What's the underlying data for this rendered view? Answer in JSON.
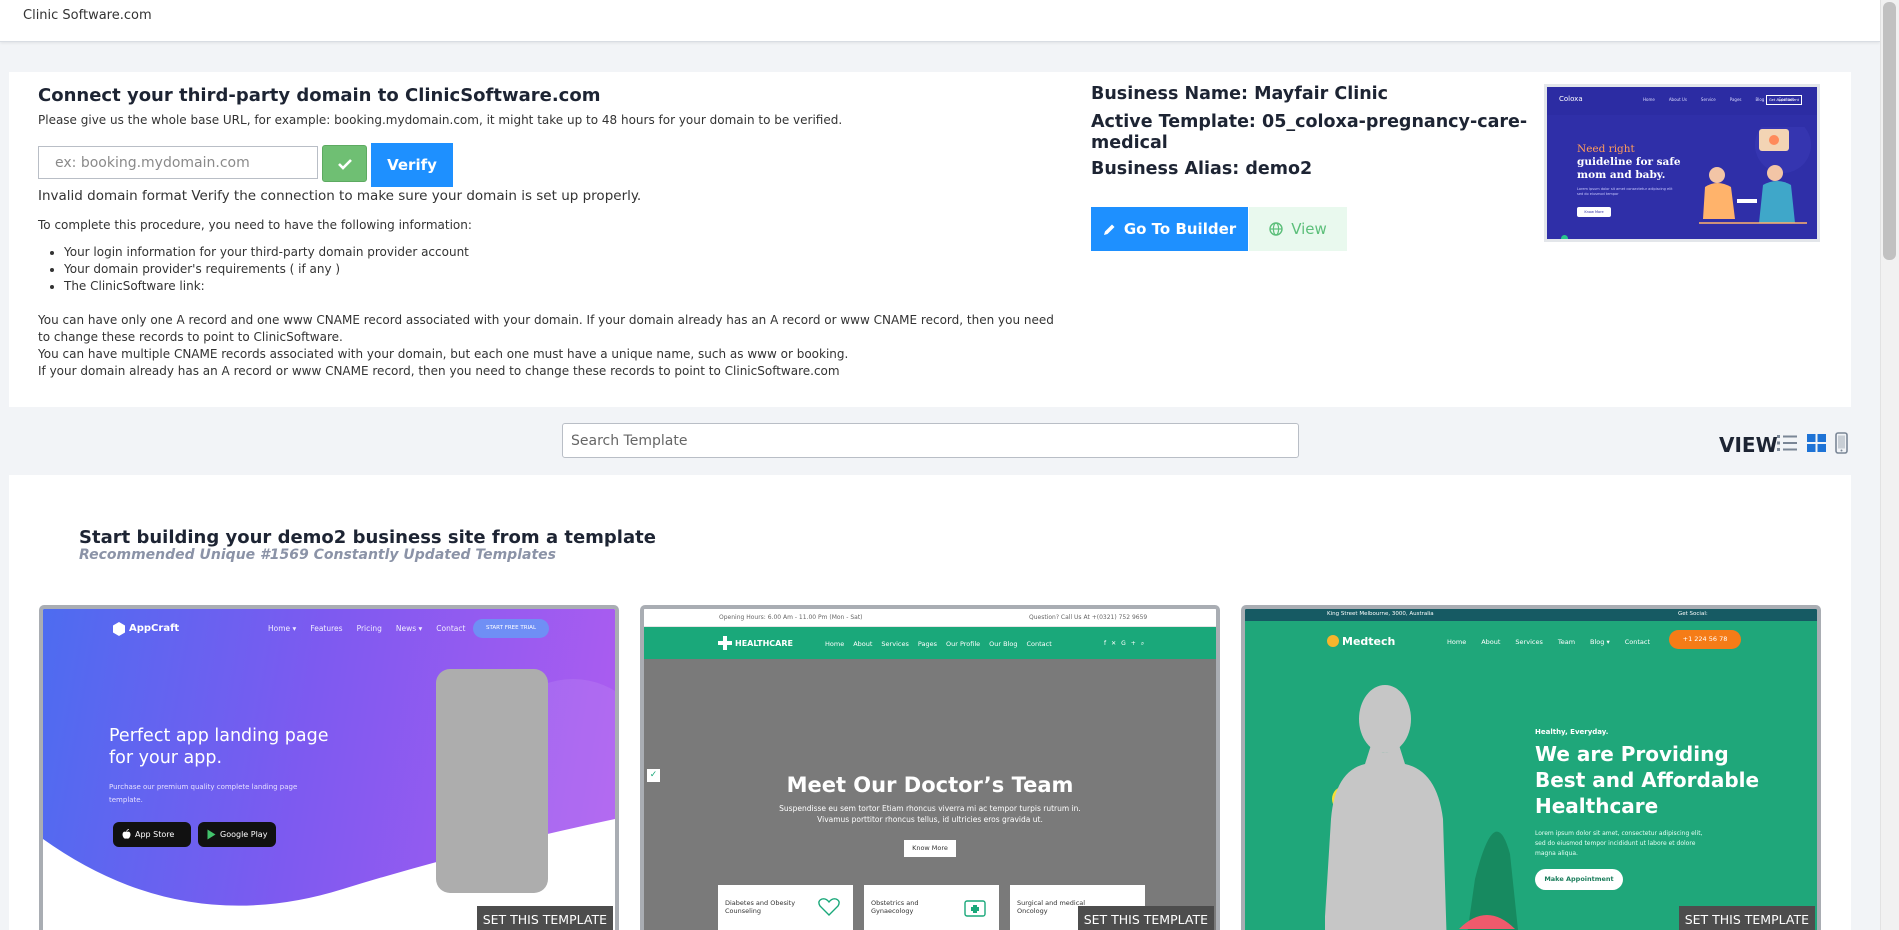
{
  "topbar": {
    "brand": "Clinic Software.com"
  },
  "domain": {
    "title": "Connect your third-party domain to ClinicSoftware.com",
    "help": "Please give us the whole base URL, for example: booking.mydomain.com, it might take up to 48 hours for your domain to be verified.",
    "input_placeholder": "ex: booking.mydomain.com",
    "verify_label": "Verify",
    "invalid_message": "Invalid domain format Verify the connection to make sure your domain is set up properly.",
    "info_intro": "To complete this procedure, you need to have the following information:",
    "requirements": [
      "Your login information for your third-party domain provider account",
      "Your domain provider's requirements ( if any )",
      "The ClinicSoftware link:"
    ],
    "notes": [
      "You can have only one A record and one www CNAME record associated with your domain. If your domain already has an A record or www CNAME record, then you need to change these records to point to ClinicSoftware.",
      "You can have multiple CNAME records associated with your domain, but each one must have a unique name, such as www or booking.",
      "If your domain already has an A record or www CNAME record, then you need to change these records to point to ClinicSoftware.com"
    ]
  },
  "business": {
    "name": "Business Name: Mayfair Clinic",
    "template": "Active Template: 05_coloxa-pregnancy-care-medical",
    "alias": "Business Alias: demo2",
    "builder_label": "Go To Builder",
    "view_label": "View",
    "preview": {
      "logo": "Coloxa",
      "nav": [
        "Home",
        "About Us",
        "Service",
        "Pages",
        "Blog",
        "Contact"
      ],
      "cta": "Get Appointment",
      "headline_1": "Need right",
      "headline_2": "guideline for safe",
      "headline_3": "mom and baby.",
      "body": "Lorem ipsum dolor sit amet consectetur adipiscing elit sed do eiusmod tempor",
      "button": "Know More"
    }
  },
  "search": {
    "placeholder": "Search Template",
    "view_label": "VIEW"
  },
  "templates": {
    "heading": "Start building your demo2 business site from a template",
    "subheading": "Recommended Unique #1569 Constantly Updated Templates",
    "set_label": "SET THIS TEMPLATE",
    "appcraft": {
      "logo": "AppCraft",
      "nav": [
        "Home ▾",
        "Features",
        "Pricing",
        "News ▾",
        "Contact"
      ],
      "cta": "START FREE TRIAL",
      "headline_1": "Perfect app landing page",
      "headline_2": "for your app.",
      "body_1": "Purchase our premium quality complete landing page",
      "body_2": "template.",
      "store_1": "App Store",
      "store_2": "Google Play"
    },
    "healthcare": {
      "hours": "Opening Hours: 6.00 Am - 11.00 Pm (Mon - Sat)",
      "phone": "Question? Call Us At +(0321) 752 9659",
      "logo": "HEALTHCARE",
      "nav": [
        "Home",
        "About",
        "Services",
        "Pages",
        "Our Profile",
        "Our Blog",
        "Contact"
      ],
      "headline": "Meet Our Doctor’s Team",
      "body_1": "Suspendisse eu sem tortor Etiam rhoncus viverra mi ac tempor turpis rutrum in.",
      "body_2": "Vivamus porttitor rhoncus tellus, id ultricies eros gravida ut.",
      "button": "Know More",
      "box_1": "Diabetes and Obesity Counseling",
      "box_2": "Obstetrics and Gynaecology",
      "box_3": "Surgical and medical Oncology"
    },
    "medtech": {
      "address": "King Street Melbourne, 3000, Australia",
      "social": "Get Social:",
      "logo": "Medtech",
      "nav": [
        "Home",
        "About",
        "Services",
        "Team",
        "Blog ▾",
        "Contact"
      ],
      "phone": "+1 224 56 78",
      "tagline": "Healthy, Everyday.",
      "headline_1": "We are Providing",
      "headline_2": "Best and Affordable",
      "headline_3": "Healthcare",
      "body_1": "Lorem ipsum dolor sit amet, consectetur adipiscing elit,",
      "body_2": "sed do eiusmod tempor incididunt ut labore et dolore",
      "body_3": "magna aliqua.",
      "button": "Make Appointment"
    }
  }
}
